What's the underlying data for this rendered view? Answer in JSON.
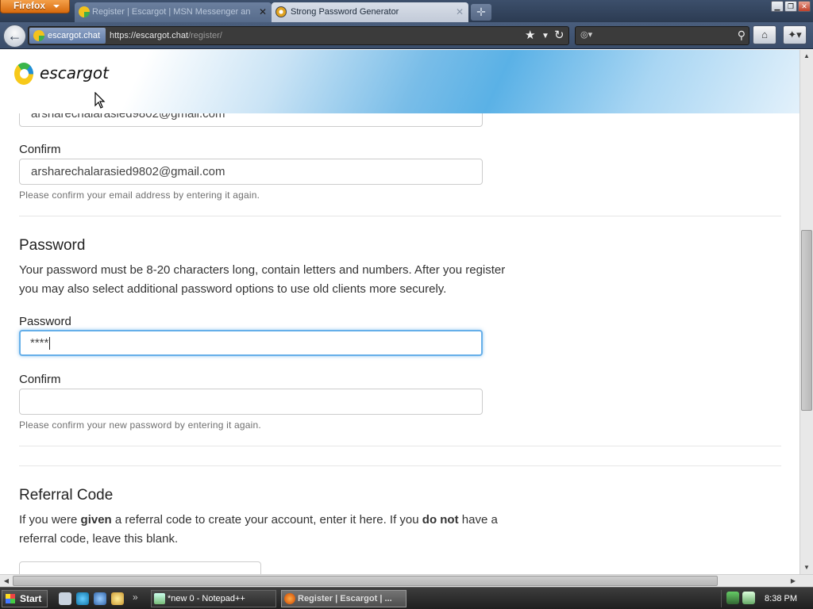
{
  "browser": {
    "app_button": "Firefox",
    "tabs": [
      {
        "title": "Register | Escargot | MSN Messenger an",
        "active": false
      },
      {
        "title": "Strong Password Generator",
        "active": true
      }
    ],
    "identity_label": "escargot.chat",
    "url_host": "https://escargot.chat",
    "url_path": "/register/"
  },
  "site": {
    "logo_text": "escargot"
  },
  "form": {
    "email_value_partial": "arsharechalarasied9802@gmail.com",
    "confirm_email_label": "Confirm",
    "confirm_email_value": "arsharechalarasied9802@gmail.com",
    "confirm_email_help": "Please confirm your email address by entering it again.",
    "password_section_title": "Password",
    "password_desc_line1": "Your password must be 8-20 characters long, contain letters and numbers. After you register",
    "password_desc_line2": "you may also select additional password options to use old clients more securely.",
    "password_label": "Password",
    "password_value": "****",
    "confirm_password_label": "Confirm",
    "confirm_password_value": "",
    "confirm_password_help": "Please confirm your new password by entering it again.",
    "referral_section_title": "Referral Code",
    "referral_desc_1": "If you were ",
    "referral_desc_bold1": "given",
    "referral_desc_2": " a referral code to create your account, enter it here. If you ",
    "referral_desc_bold2": "do not",
    "referral_desc_3": " have a",
    "referral_desc_line2": "referral code, leave this blank."
  },
  "taskbar": {
    "start_label": "Start",
    "tasks": [
      {
        "label": "*new 0 - Notepad++"
      },
      {
        "label": "Register | Escargot | ..."
      }
    ],
    "clock": "8:38 PM"
  },
  "colors": {
    "focus_ring": "#66afe9",
    "firefox_orange": "#e07a1f"
  }
}
